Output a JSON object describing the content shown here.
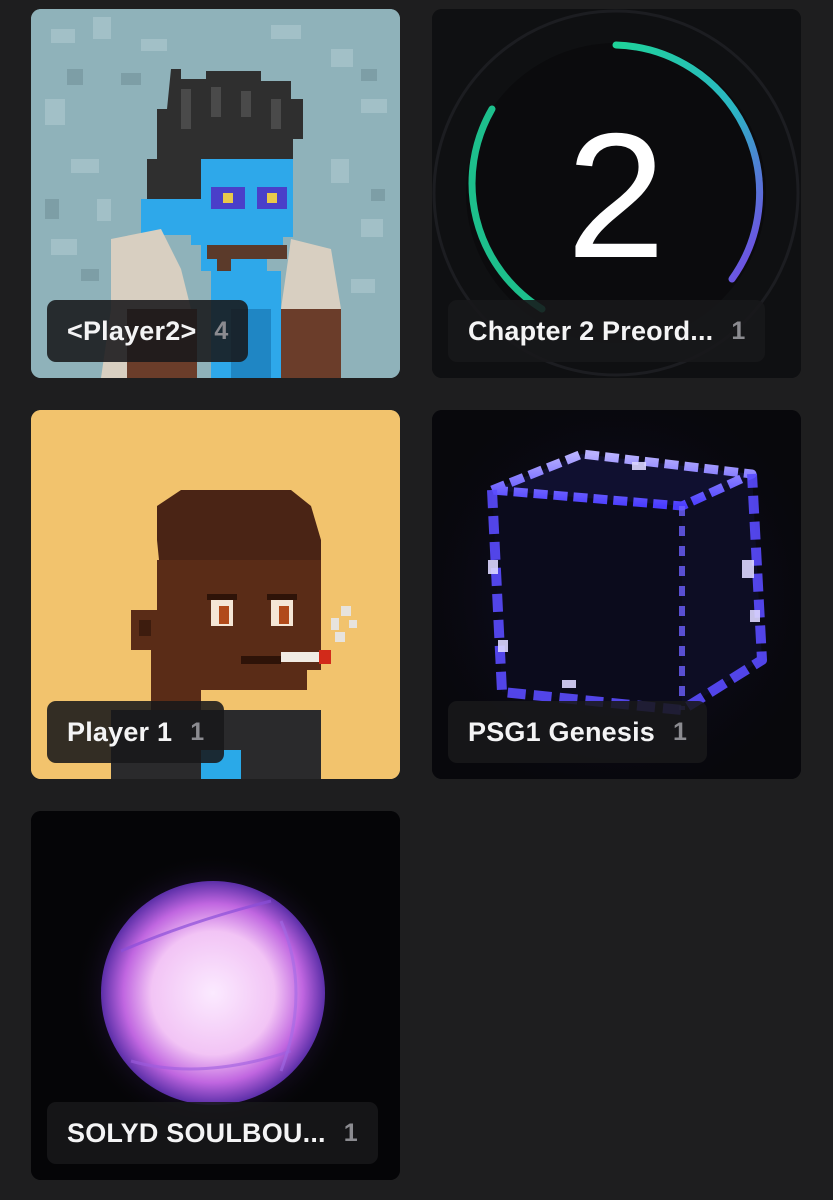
{
  "collections": [
    {
      "name": "<Player2>",
      "count": "4",
      "art": "pixel-punk-blue-face"
    },
    {
      "name": "Chapter 2 Preord...",
      "count": "1",
      "art": "number-two-ring"
    },
    {
      "name": "Player 1",
      "count": "1",
      "art": "pixel-punk-smoker"
    },
    {
      "name": "PSG1 Genesis",
      "count": "1",
      "art": "glowing-cube"
    },
    {
      "name": "SOLYD SOULBOU...",
      "count": "1",
      "art": "glowing-orb"
    }
  ],
  "colors": {
    "background": "#1e1e1f",
    "pill_background": "#18181a",
    "label_text": "#f4f4f5",
    "count_text": "#8b8b90"
  }
}
